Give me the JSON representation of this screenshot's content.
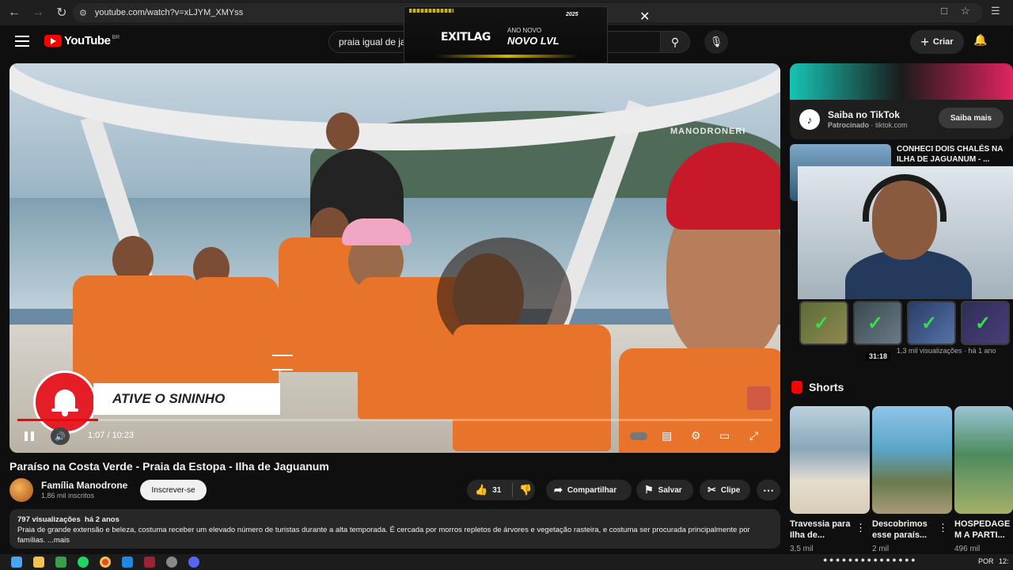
{
  "browser": {
    "url": "youtube.com/watch?v=xLJYM_XMYss"
  },
  "masthead": {
    "logo_text": "YouTube",
    "country_code": "BR",
    "search_value": "praia igual de ja",
    "create_label": "Criar"
  },
  "ad_overlay": {
    "brand": "EXITLAG",
    "tagline_small": "ANO NOVO",
    "tagline_big": "NOVO LVL",
    "year": "2025"
  },
  "player": {
    "watermark": "MANODRONERI",
    "overlay_cta": "ATIVE O SININHO",
    "time_current": "1:07",
    "time_total": "10:23",
    "time_display": "1:07 / 10:23",
    "progress": 0.107
  },
  "video": {
    "title": "Paraíso na Costa Verde - Praia da Estopa - Ilha de Jaguanum",
    "channel": "Família Manodrone",
    "subscribers": "1,86 mil inscritos",
    "subscribe_label": "Inscrever-se",
    "likes": "31",
    "share_label": "Compartilhar",
    "save_label": "Salvar",
    "clip_label": "Clipe",
    "views": "797 visualizações",
    "age": "há 2 anos",
    "description": "Praia de grande extensão e beleza, costuma receber um elevado número de turistas durante a alta temporada. É cercada por morros repletos de árvores e vegetação rasteira, e costuma ser procurada principalmente por famílias. ...mais"
  },
  "sidebar": {
    "sponsor": {
      "title": "Saiba no TikTok",
      "sponsored": "Patrocinado",
      "domain": "tiktok.com",
      "button": "Saiba mais"
    },
    "rec1": {
      "title": "CONHECI DOIS CHALÉS NA ILHA DE JAGUANUM - ..."
    },
    "rec2": {
      "duration": "31:18",
      "meta": "1,3 mil visualizações · há 1 ano"
    },
    "shorts_label": "Shorts",
    "shorts": [
      {
        "title": "Travessia para Ilha de...",
        "views": "3,5 mil"
      },
      {
        "title": "Descobrimos esse paraís...",
        "views": "2 mil"
      },
      {
        "title": "HOSPEDAGE M A PARTI...",
        "views": "496 mil"
      }
    ]
  },
  "taskbar": {
    "lang": "POR",
    "clock": "12:"
  }
}
